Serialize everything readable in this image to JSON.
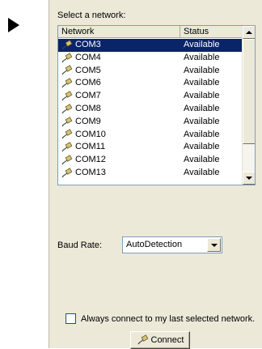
{
  "panel": {
    "select_label": "Select a network:",
    "columns": {
      "network": "Network",
      "status": "Status"
    },
    "networks": [
      {
        "name": "COM3",
        "status": "Available",
        "selected": true
      },
      {
        "name": "COM4",
        "status": "Available"
      },
      {
        "name": "COM5",
        "status": "Available"
      },
      {
        "name": "COM6",
        "status": "Available"
      },
      {
        "name": "COM7",
        "status": "Available"
      },
      {
        "name": "COM8",
        "status": "Available"
      },
      {
        "name": "COM9",
        "status": "Available"
      },
      {
        "name": "COM10",
        "status": "Available"
      },
      {
        "name": "COM11",
        "status": "Available"
      },
      {
        "name": "COM12",
        "status": "Available"
      },
      {
        "name": "COM13",
        "status": "Available"
      }
    ],
    "baud_label": "Baud Rate:",
    "baud_value": "AutoDetection",
    "always_connect_label": "Always connect to my last selected network.",
    "always_connect_checked": false,
    "connect_label": "Connect"
  },
  "icons": {
    "network_item": "serial-plug-icon",
    "expand": "play-arrow-icon"
  },
  "colors": {
    "selection": "#0a246a",
    "panel_bg": "#ece9d8"
  }
}
